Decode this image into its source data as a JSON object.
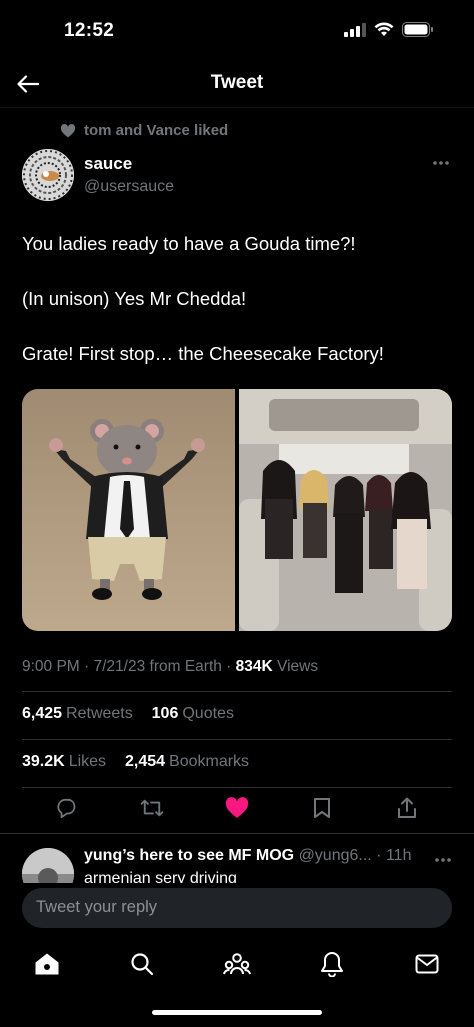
{
  "status": {
    "time": "12:52"
  },
  "header": {
    "title": "Tweet"
  },
  "social_context": "tom and Vance liked",
  "tweet": {
    "author_name": "sauce",
    "author_handle": "@usersauce",
    "text_lines": [
      "You ladies ready to have a Gouda time?!",
      "(In unison) Yes Mr Chedda!",
      "Grate! First stop… the Cheesecake Factory!"
    ],
    "timestamp": "9:00 PM · 7/21/23 from Earth · ",
    "views_count": "834K",
    "views_label": "Views",
    "retweets_count": "6,425",
    "retweets_label": "Retweets",
    "quotes_count": "106",
    "quotes_label": "Quotes",
    "likes_count": "39.2K",
    "likes_label": "Likes",
    "bookmarks_count": "2,454",
    "bookmarks_label": "Bookmarks"
  },
  "reply": {
    "name": "yung’s here to see MF MOG",
    "handle_time": "@yung6... · 11h",
    "snippet": "armenian sery driving"
  },
  "composer": {
    "placeholder": "Tweet your reply"
  },
  "colors": {
    "like_active": "#f91880",
    "muted": "#71767b",
    "background": "#000000"
  }
}
